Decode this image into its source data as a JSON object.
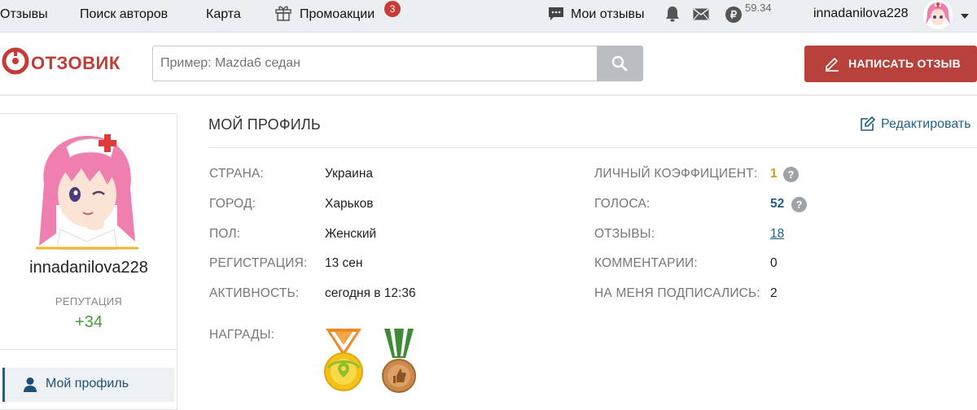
{
  "topnav": {
    "reviews": "Отзывы",
    "author_search": "Поиск авторов",
    "map": "Карта",
    "promos": "Промоакции",
    "promos_badge": "3",
    "my_reviews": "Мои отзывы",
    "coin_value": "59.34",
    "username": "innadanilova228",
    "icons": [
      "gift-icon",
      "chat-icon",
      "bell-icon",
      "mail-icon",
      "ruble-coin-icon"
    ]
  },
  "header": {
    "logo_text": "ОТЗОВИК",
    "search_placeholder": "Пример: Mazda6 седан",
    "write_button": "НАПИСАТЬ ОТЗЫВ"
  },
  "sidebar": {
    "username": "innadanilova228",
    "reputation_label": "РЕПУТАЦИЯ",
    "reputation_value": "+34",
    "menu_active": "Мой профиль"
  },
  "profile": {
    "title": "МОЙ ПРОФИЛЬ",
    "edit_label": "Редактировать",
    "left_fields": [
      {
        "label": "СТРАНА:",
        "value": "Украина"
      },
      {
        "label": "ГОРОД:",
        "value": "Харьков"
      },
      {
        "label": "ПОЛ:",
        "value": "Женский"
      },
      {
        "label": "РЕГИСТРАЦИЯ:",
        "value": "13 сен"
      },
      {
        "label": "АКТИВНОСТЬ:",
        "value": "сегодня в 12:36"
      }
    ],
    "right_fields": [
      {
        "label": "ЛИЧНЫЙ КОЭФФИЦИЕНТ:",
        "value": "1"
      },
      {
        "label": "ГОЛОСА:",
        "value": "52"
      },
      {
        "label": "ОТЗЫВЫ:",
        "value": "18"
      },
      {
        "label": "КОММЕНТАРИИ:",
        "value": "0"
      },
      {
        "label": "НА МЕНЯ ПОДПИСАЛИСЬ:",
        "value": "2"
      }
    ],
    "awards_label": "НАГРАДЫ:",
    "help_mark": "?"
  },
  "colors": {
    "brand_red": "#c53b35",
    "link_blue": "#1e5f8b",
    "reputation_green": "#4a9a3a",
    "coef_gold": "#d49a14"
  }
}
